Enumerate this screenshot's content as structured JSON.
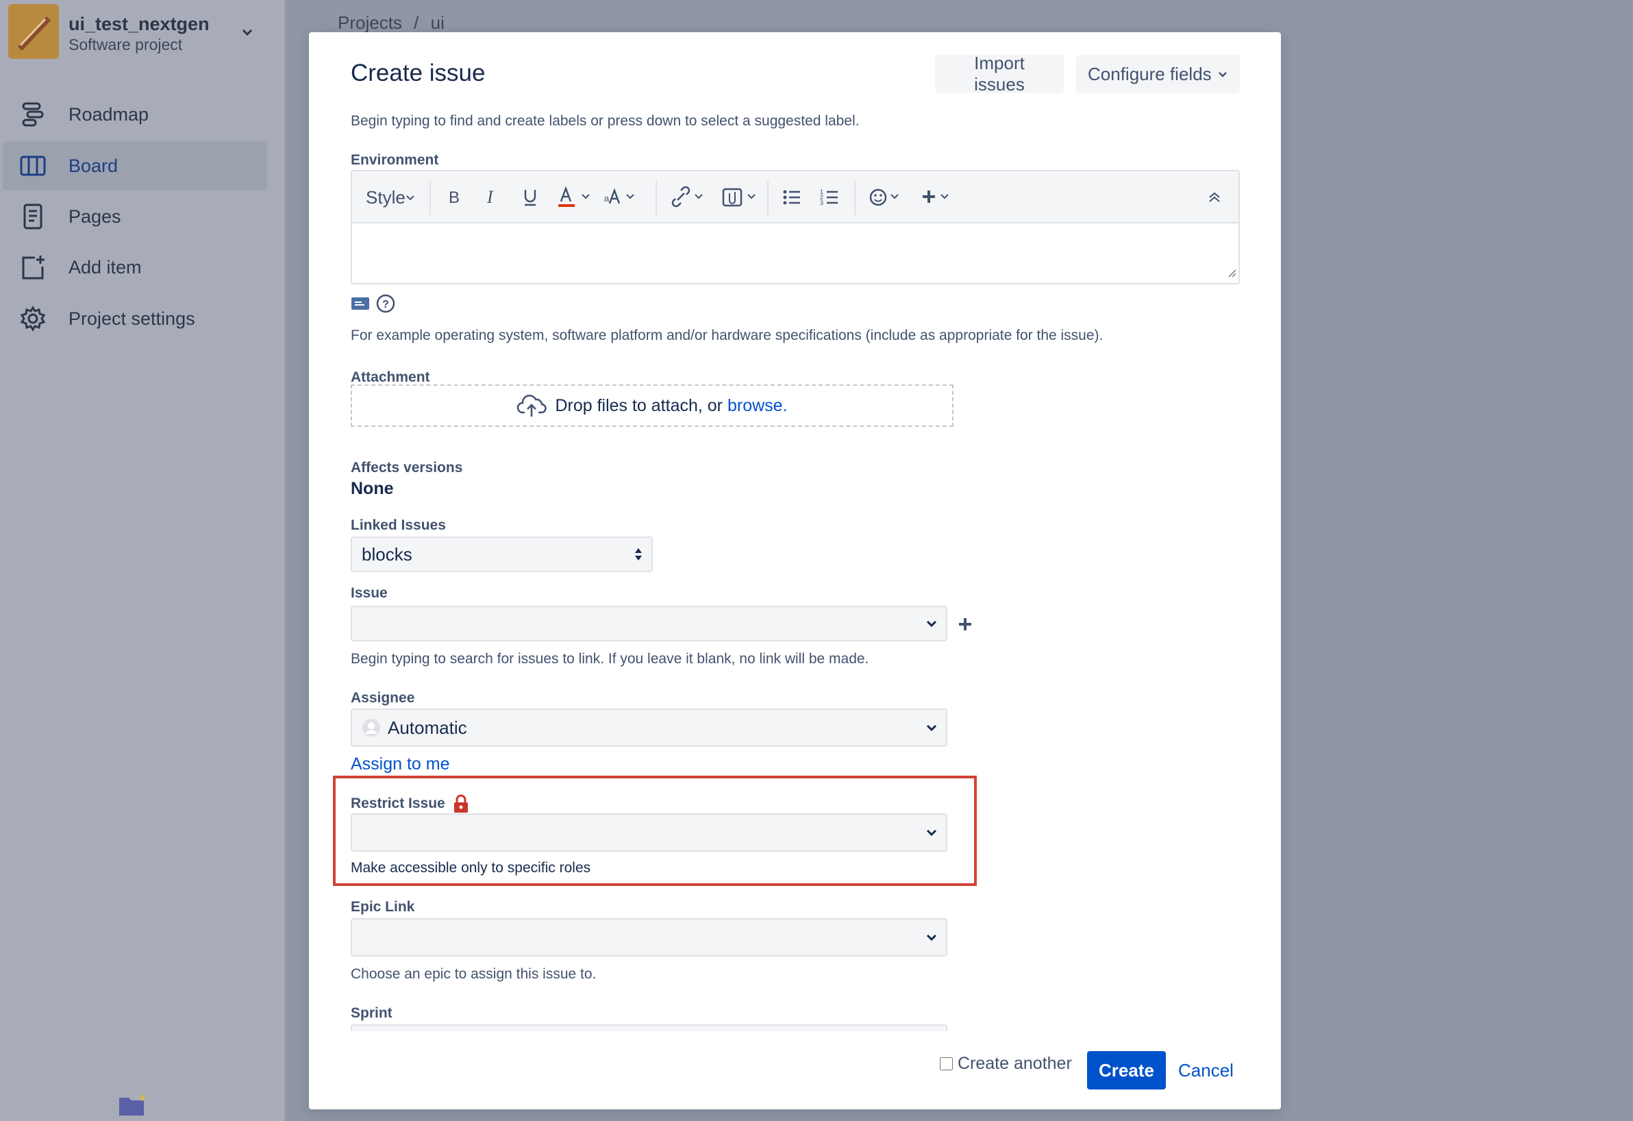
{
  "sidebar": {
    "project_name": "ui_test_nextgen",
    "project_type": "Software project",
    "items": [
      {
        "label": "Roadmap",
        "icon": "roadmap-icon"
      },
      {
        "label": "Board",
        "icon": "board-icon",
        "active": true
      },
      {
        "label": "Pages",
        "icon": "pages-icon"
      },
      {
        "label": "Add item",
        "icon": "add-item-icon"
      },
      {
        "label": "Project settings",
        "icon": "gear-icon"
      }
    ]
  },
  "breadcrumb": {
    "root": "Projects",
    "separator": "/",
    "current": "ui"
  },
  "modal": {
    "title": "Create issue",
    "import_label": "Import issues",
    "configure_label": "Configure fields",
    "labels_help": "Begin typing to find and create labels or press down to select a suggested label.",
    "environment": {
      "label": "Environment",
      "style_label": "Style",
      "help": "For example operating system, software platform and/or hardware specifications (include as appropriate for the issue)."
    },
    "attachment": {
      "label": "Attachment",
      "drop_text": "Drop files to attach, or",
      "browse_text": "browse."
    },
    "affects_versions": {
      "label": "Affects versions",
      "value": "None"
    },
    "linked_issues": {
      "label": "Linked Issues",
      "value": "blocks"
    },
    "issue": {
      "label": "Issue",
      "help": "Begin typing to search for issues to link. If you leave it blank, no link will be made."
    },
    "assignee": {
      "label": "Assignee",
      "value": "Automatic",
      "assign_to_me": "Assign to me"
    },
    "restrict_issue": {
      "label": "Restrict Issue",
      "help": "Make accessible only to specific roles"
    },
    "epic_link": {
      "label": "Epic Link",
      "help": "Choose an epic to assign this issue to."
    },
    "sprint": {
      "label": "Sprint"
    },
    "footer": {
      "create_another": "Create another",
      "create": "Create",
      "cancel": "Cancel"
    }
  },
  "colors": {
    "accent": "#0052cc",
    "highlight_frame": "#d04437",
    "lock_icon": "#c9372c"
  }
}
